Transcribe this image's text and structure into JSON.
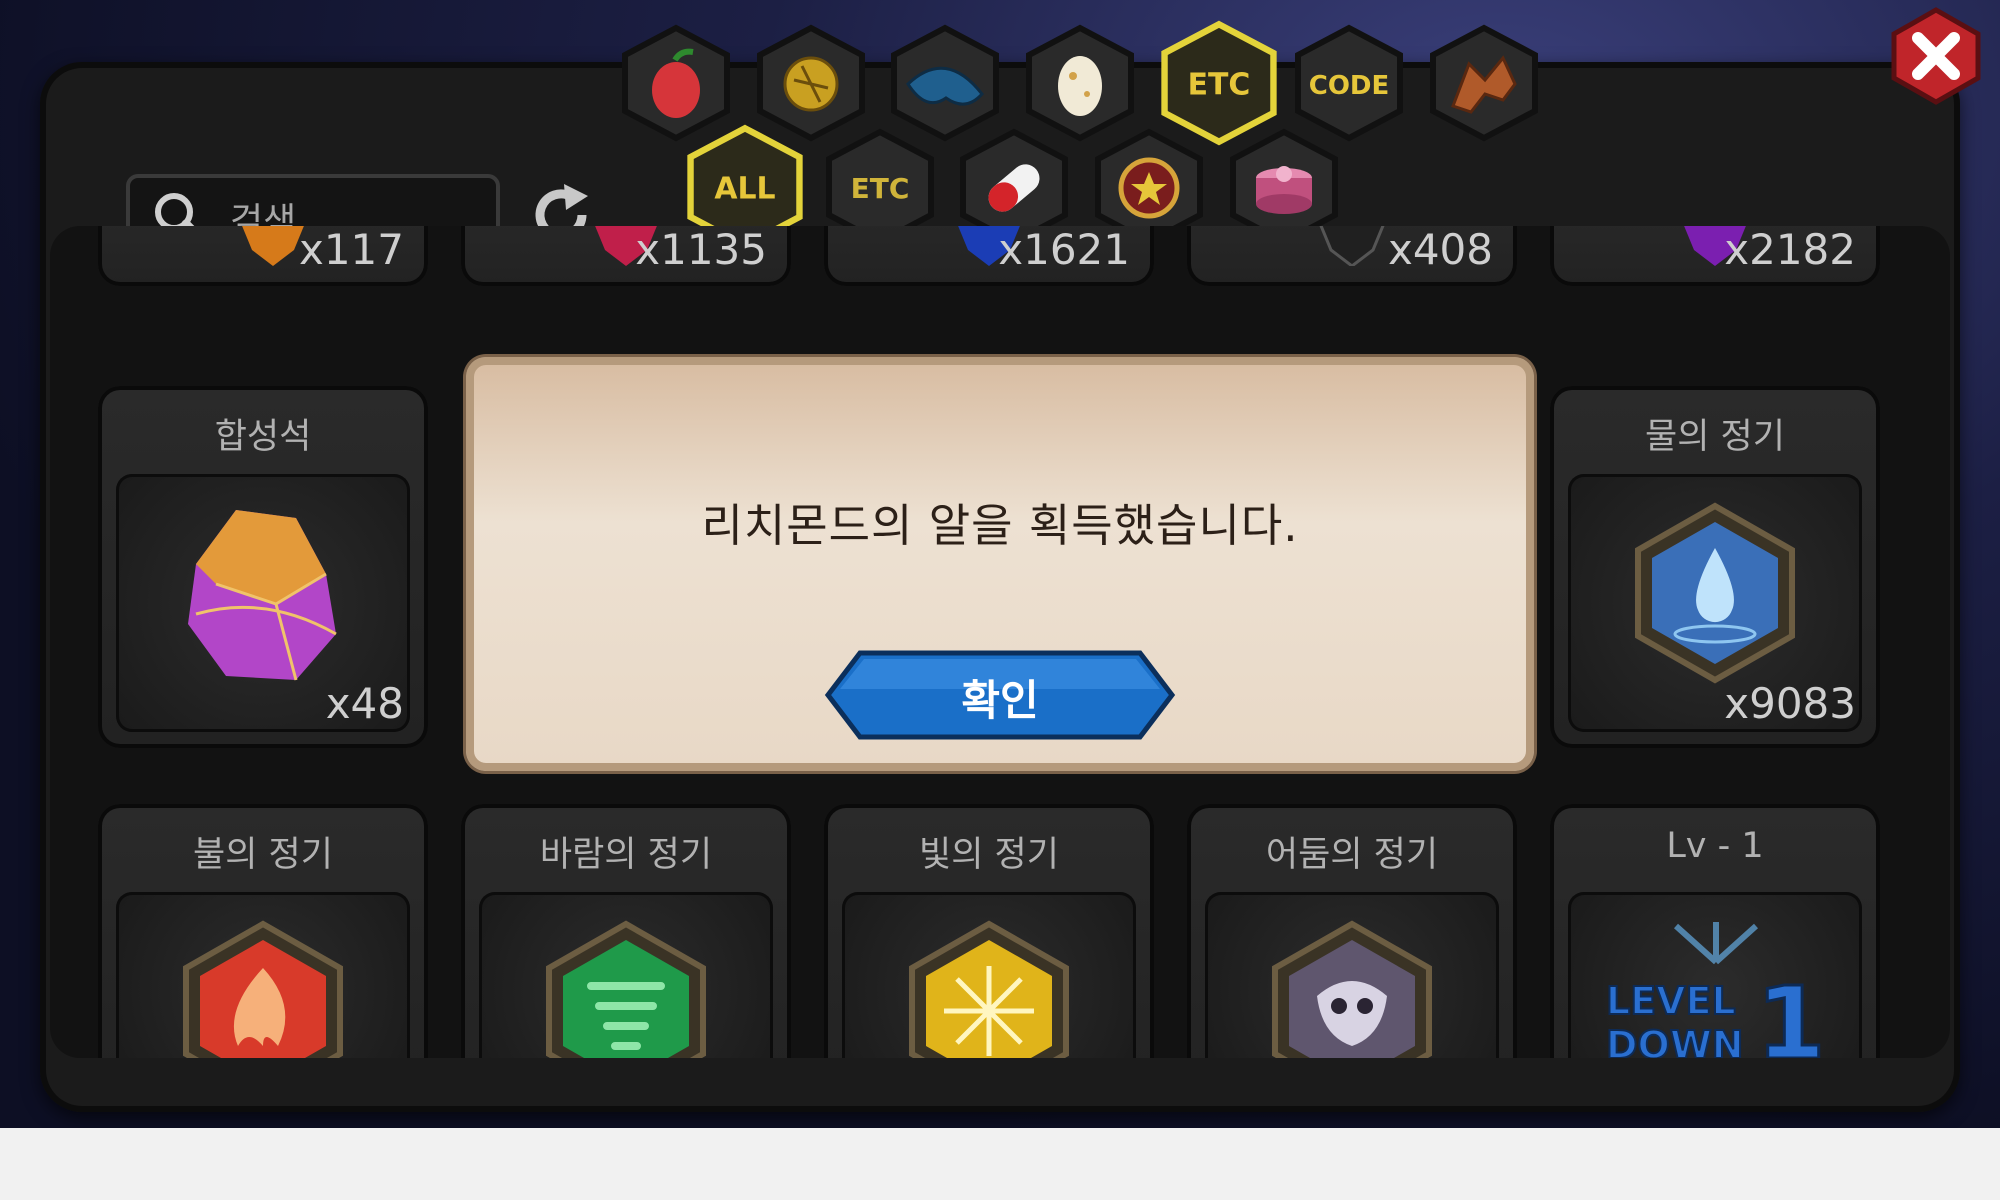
{
  "search": {
    "placeholder": "검색"
  },
  "tabs_row1": [
    {
      "name": "fruit",
      "label": ""
    },
    {
      "name": "gold",
      "label": ""
    },
    {
      "name": "scale",
      "label": ""
    },
    {
      "name": "egg",
      "label": ""
    },
    {
      "name": "etc",
      "label": "ETC",
      "active": true
    },
    {
      "name": "code",
      "label": "CODE"
    },
    {
      "name": "dragon",
      "label": ""
    }
  ],
  "tabs_row2": [
    {
      "name": "all",
      "label": "ALL",
      "active": true
    },
    {
      "name": "etc",
      "label": "ETC"
    },
    {
      "name": "pill",
      "label": ""
    },
    {
      "name": "medal",
      "label": ""
    },
    {
      "name": "giftbox",
      "label": ""
    }
  ],
  "top_row": [
    {
      "count": "x117",
      "gem": "#d67a1a"
    },
    {
      "count": "x1135",
      "gem": "#c01f4a"
    },
    {
      "count": "x1621",
      "gem": "#1b3db5"
    },
    {
      "count": "x408",
      "gem": "#202020"
    },
    {
      "count": "x2182",
      "gem": "#7b1fb0"
    }
  ],
  "middle_row": [
    {
      "title": "합성석",
      "count": "x48"
    },
    {
      "title": "물의 정기",
      "count": "x9083"
    }
  ],
  "bottom_row": [
    {
      "title": "불의 정기",
      "color": "#d83a2a"
    },
    {
      "title": "바람의 정기",
      "color": "#1f9a4a"
    },
    {
      "title": "빛의 정기",
      "color": "#e0b41a"
    },
    {
      "title": "어둠의 정기",
      "color": "#6a5f7a"
    },
    {
      "title": "Lv - 1",
      "badge": [
        "LEVEL",
        "DOWN",
        "1"
      ]
    }
  ],
  "modal": {
    "message": "리치몬드의 알을 획득했습니다.",
    "ok_label": "확인"
  }
}
